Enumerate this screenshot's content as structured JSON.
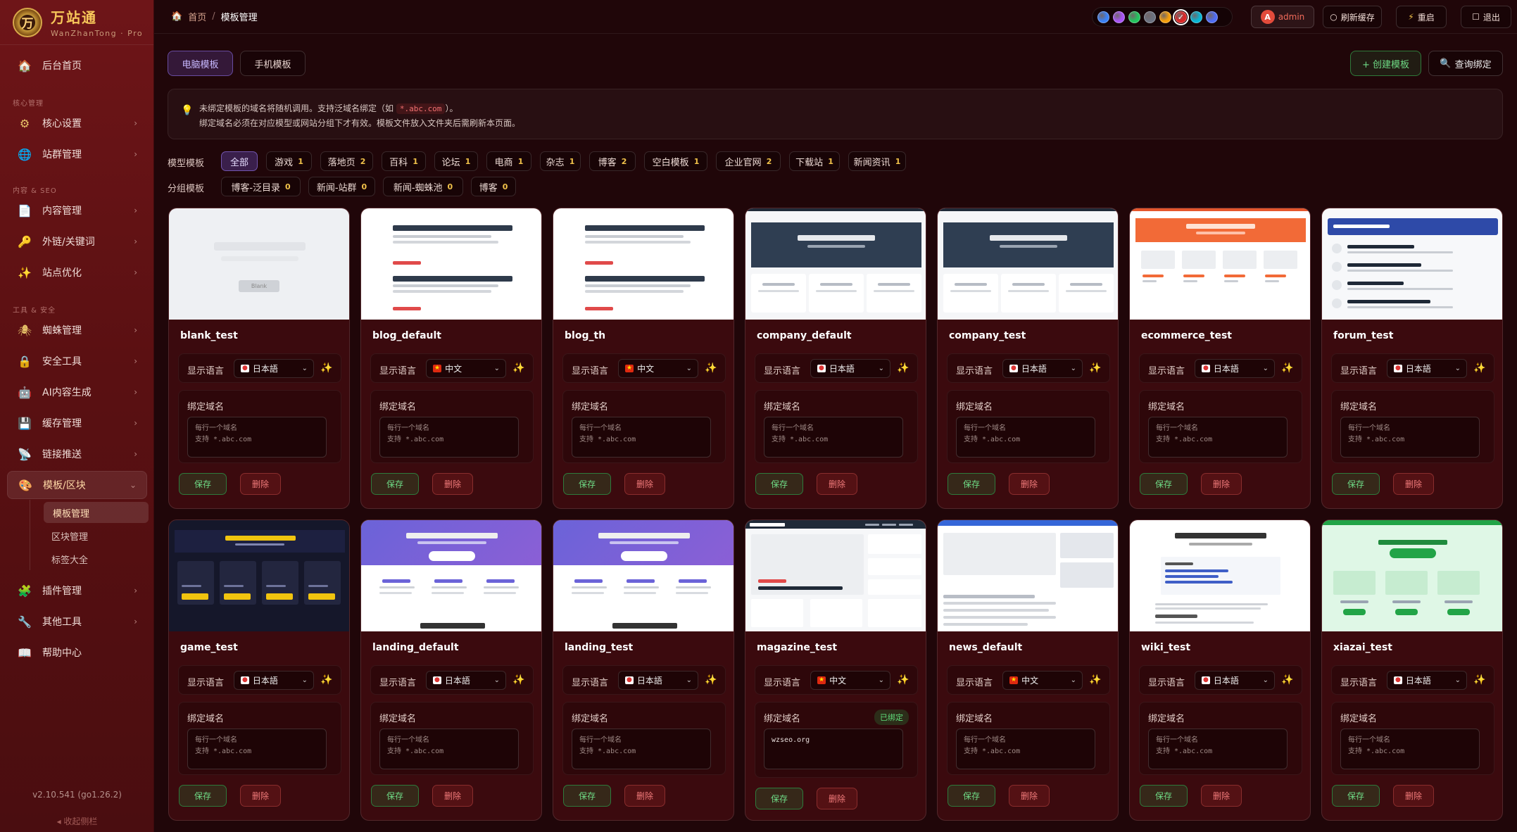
{
  "app": {
    "name": "万站通",
    "subtitle": "WanZhanTong · Pro",
    "logo_char": "万",
    "version": "v2.10.541 (go1.26.2)",
    "collapse_label": "◂ 收起侧栏"
  },
  "sidebar": {
    "items": [
      {
        "label": "后台首页",
        "icon": "home-icon",
        "glyph": "🏠"
      },
      {
        "label": "核心设置",
        "icon": "gear-icon",
        "glyph": "⚙"
      },
      {
        "label": "站群管理",
        "icon": "globe-icon",
        "glyph": "🌐"
      },
      {
        "label": "内容管理",
        "icon": "document-icon",
        "glyph": "📄"
      },
      {
        "label": "外链/关键词",
        "icon": "key-icon",
        "glyph": "🔑"
      },
      {
        "label": "站点优化",
        "icon": "sparkle-icon",
        "glyph": "✨"
      },
      {
        "label": "蜘蛛管理",
        "icon": "spider-icon",
        "glyph": "🕷"
      },
      {
        "label": "安全工具",
        "icon": "lock-icon",
        "glyph": "🔒"
      },
      {
        "label": "AI内容生成",
        "icon": "robot-icon",
        "glyph": "🤖"
      },
      {
        "label": "缓存管理",
        "icon": "disk-icon",
        "glyph": "💾"
      },
      {
        "label": "链接推送",
        "icon": "satellite-icon",
        "glyph": "📡"
      },
      {
        "label": "模板/区块",
        "icon": "palette-icon",
        "glyph": "🎨"
      },
      {
        "label": "插件管理",
        "icon": "puzzle-icon",
        "glyph": "🧩"
      },
      {
        "label": "其他工具",
        "icon": "wrench-icon",
        "glyph": "🔧"
      },
      {
        "label": "帮助中心",
        "icon": "book-icon",
        "glyph": "📖"
      }
    ],
    "sections": [
      "核心管理",
      "内容 & SEO",
      "工具 & 安全"
    ],
    "subitems": [
      "模板管理",
      "区块管理",
      "标签大全"
    ]
  },
  "topbar": {
    "breadcrumb_home": "首页",
    "breadcrumb_current": "模板管理",
    "theme_colors": [
      "#3b82f6",
      "#a855f7",
      "#22c55e",
      "#6b7280",
      "#f59e0b",
      "#dc2626",
      "#06b6d4",
      "#4f6df5"
    ],
    "admin": "admin",
    "avatar_letter": "A",
    "refresh_cache": "刷新缓存",
    "restart": "重启",
    "logout": "退出"
  },
  "tabs": {
    "pc": "电脑模板",
    "mobile": "手机模板"
  },
  "actions": {
    "create": "+ 创建模板",
    "query": "查询绑定"
  },
  "notice": {
    "line1_a": "未绑定模板的域名将随机调用。支持泛域名绑定（如 ",
    "line1_code": "*.abc.com",
    "line1_b": "）。",
    "line2": "绑定域名必须在对应模型或网站分组下才有效。模板文件放入文件夹后需刷新本页面。"
  },
  "filters": {
    "model_label": "模型模板",
    "group_label": "分组模板",
    "models": [
      {
        "name": "全部",
        "count": ""
      },
      {
        "name": "游戏",
        "count": "1"
      },
      {
        "name": "落地页",
        "count": "2"
      },
      {
        "name": "百科",
        "count": "1"
      },
      {
        "name": "论坛",
        "count": "1"
      },
      {
        "name": "电商",
        "count": "1"
      },
      {
        "name": "杂志",
        "count": "1"
      },
      {
        "name": "博客",
        "count": "2"
      },
      {
        "name": "空白模板",
        "count": "1"
      },
      {
        "name": "企业官网",
        "count": "2"
      },
      {
        "name": "下载站",
        "count": "1"
      },
      {
        "name": "新闻资讯",
        "count": "1"
      }
    ],
    "groups": [
      {
        "name": "博客-泛目录",
        "count": "0"
      },
      {
        "name": "新闻-站群",
        "count": "0"
      },
      {
        "name": "新闻-蜘蛛池",
        "count": "0"
      },
      {
        "name": "博客",
        "count": "0"
      }
    ]
  },
  "card_labels": {
    "lang": "显示语言",
    "domain": "绑定域名",
    "placeholder": "每行一个域名\n支持 *.abc.com",
    "save": "保存",
    "delete": "删除",
    "bound": "已绑定",
    "blank_thumb_text": "Blank"
  },
  "templates": [
    {
      "name": "blank_test",
      "lang": "日本語",
      "flag": "jp",
      "thumb": "blank"
    },
    {
      "name": "blog_default",
      "lang": "中文",
      "flag": "cn",
      "thumb": "blog"
    },
    {
      "name": "blog_th",
      "lang": "中文",
      "flag": "cn",
      "thumb": "blog"
    },
    {
      "name": "company_default",
      "lang": "日本語",
      "flag": "jp",
      "thumb": "company"
    },
    {
      "name": "company_test",
      "lang": "日本語",
      "flag": "jp",
      "thumb": "company"
    },
    {
      "name": "ecommerce_test",
      "lang": "日本語",
      "flag": "jp",
      "thumb": "ecommerce"
    },
    {
      "name": "forum_test",
      "lang": "日本語",
      "flag": "jp",
      "thumb": "forum"
    },
    {
      "name": "game_test",
      "lang": "日本語",
      "flag": "jp",
      "thumb": "game"
    },
    {
      "name": "landing_default",
      "lang": "日本語",
      "flag": "jp",
      "thumb": "landing"
    },
    {
      "name": "landing_test",
      "lang": "日本語",
      "flag": "jp",
      "thumb": "landing"
    },
    {
      "name": "magazine_test",
      "lang": "中文",
      "flag": "cn",
      "thumb": "magazine",
      "domain": "wzseo.org"
    },
    {
      "name": "news_default",
      "lang": "中文",
      "flag": "cn",
      "thumb": "news"
    },
    {
      "name": "wiki_test",
      "lang": "日本語",
      "flag": "jp",
      "thumb": "wiki"
    },
    {
      "name": "xiazai_test",
      "lang": "日本語",
      "flag": "jp",
      "thumb": "xiazai"
    }
  ]
}
